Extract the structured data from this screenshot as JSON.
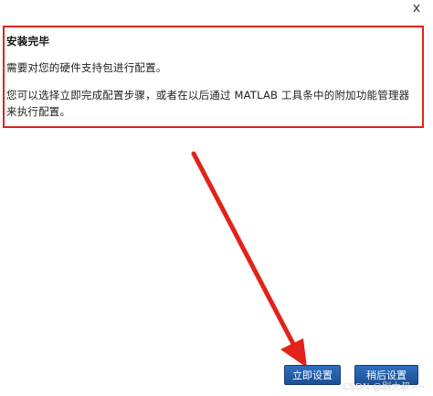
{
  "dialog": {
    "title": "安装完毕",
    "message_line1": "需要对您的硬件支持包进行配置。",
    "message_line2": "您可以选择立即完成配置步骤，或者在以后通过 MATLAB 工具条中的附加功能管理器来执行配置。"
  },
  "buttons": {
    "setup_now": "立即设置",
    "setup_later": "稍后设置"
  },
  "colors": {
    "highlight": "#e2231a",
    "button": "#1f5aa6"
  },
  "watermark": "CSDN @别大叔~~"
}
